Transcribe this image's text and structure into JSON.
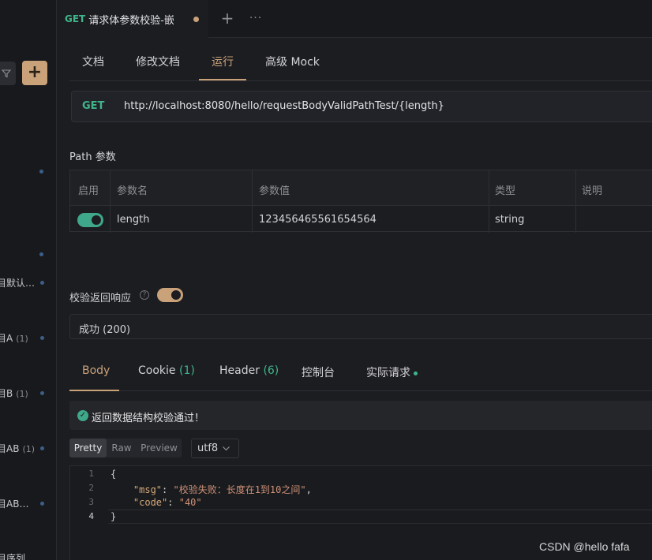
{
  "sidebar": {
    "add_label": "+",
    "items": [
      {
        "label": "目默认…",
        "count": ""
      },
      {
        "label": "目A",
        "count": "(1)"
      },
      {
        "label": "目B",
        "count": "(1)"
      },
      {
        "label": "目AB",
        "count": "(1)"
      },
      {
        "label": "目AB…",
        "count": ""
      },
      {
        "label": "目序列",
        "count": ""
      }
    ]
  },
  "tab": {
    "method": "GET",
    "title": "请求体参数校验-嵌套",
    "plus": "+",
    "more": "···"
  },
  "subnav": {
    "items": [
      "文档",
      "修改文档",
      "运行",
      "高级 Mock"
    ],
    "active": "运行"
  },
  "request": {
    "method": "GET",
    "url": "http://localhost:8080/hello/requestBodyValidPathTest/{length}"
  },
  "path_params": {
    "title": "Path 参数",
    "columns": [
      "启用",
      "参数名",
      "参数值",
      "类型",
      "说明"
    ],
    "rows": [
      {
        "enabled": true,
        "name": "length",
        "value": "123456465561654564",
        "type": "string",
        "desc": ""
      }
    ]
  },
  "validate": {
    "label": "校验返回响应",
    "help": "?",
    "enabled": true,
    "response": "成功 (200)"
  },
  "response_tabs": {
    "body": "Body",
    "cookie": "Cookie",
    "cookie_count": "(1)",
    "header": "Header",
    "header_count": "(6)",
    "console": "控制台",
    "actual": "实际请求"
  },
  "banner": {
    "message": "返回数据结构校验通过！"
  },
  "view_modes": {
    "pretty": "Pretty",
    "raw": "Raw",
    "preview": "Preview",
    "encoding": "utf8"
  },
  "code": {
    "line_numbers": [
      "1",
      "2",
      "3",
      "4"
    ],
    "open": "{",
    "close": "}",
    "msg_key": "\"msg\"",
    "msg_value": "\"校验失败：长度在1到10之间\"",
    "code_key": "\"code\"",
    "code_value": "\"40\""
  },
  "watermark": "CSDN @hello fafa"
}
